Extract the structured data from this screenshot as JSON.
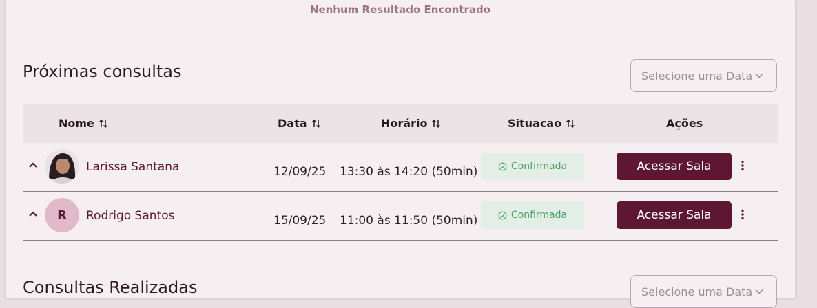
{
  "empty_message": "Nenhum Resultado Encontrado",
  "upcoming": {
    "title": "Próximas consultas",
    "date_select_placeholder": "Selecione uma Data",
    "columns": {
      "name": "Nome",
      "date": "Data",
      "time": "Horário",
      "status": "Situacao",
      "actions": "Ações"
    },
    "rows": [
      {
        "avatar": "photo",
        "name": "Larissa Santana",
        "date": "12/09/25",
        "time": "13:30 às 14:20 (50min)",
        "status": "Confirmada",
        "action": "Acessar Sala"
      },
      {
        "avatar_initial": "R",
        "name": "Rodrigo Santos",
        "date": "15/09/25",
        "time": "11:00 às 11:50 (50min)",
        "status": "Confirmada",
        "action": "Acessar Sala"
      }
    ]
  },
  "done": {
    "title": "Consultas Realizadas",
    "date_select_placeholder": "Selecione uma Data"
  },
  "icons": {
    "sort": "sort-arrows-icon",
    "expand": "chevron-up-icon",
    "status": "check-circle-icon",
    "select": "chevron-down-icon",
    "more": "kebab-menu-icon"
  },
  "colors": {
    "primary": "#5e1733",
    "status_bg": "#e3efe6",
    "status_text": "#4fa065",
    "avatar_initial_bg": "#e2b9c8"
  }
}
